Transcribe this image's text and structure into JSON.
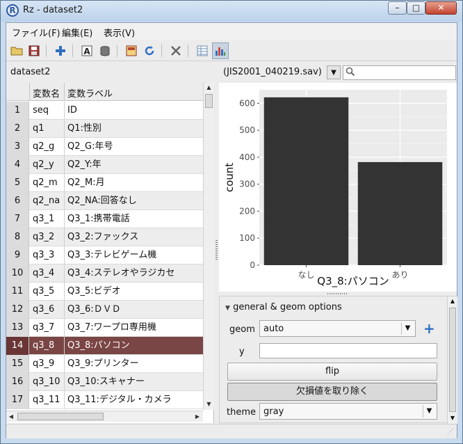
{
  "window": {
    "title": "Rz - dataset2",
    "app_icon_glyph": "R",
    "controls": {
      "minimize": "–",
      "maximize": "□",
      "close": "✕"
    }
  },
  "menu": [
    "ファイル(F)",
    "編集(E)",
    "表示(V)"
  ],
  "toolbar": [
    {
      "name": "open-folder-icon",
      "glyph": "📂",
      "color": "#c9a13b"
    },
    {
      "name": "save-icon",
      "glyph": "💾",
      "color": "#8a2e2e"
    },
    {
      "name": "add-icon",
      "glyph": "+",
      "color": "#2f6fc2"
    },
    {
      "name": "text-icon",
      "glyph": "A",
      "color": "#222222"
    },
    {
      "name": "trash-icon",
      "glyph": "🗑",
      "color": "#555555"
    },
    {
      "name": "data-editor-icon",
      "glyph": "▦",
      "color": "#b5462f"
    },
    {
      "name": "refresh-icon",
      "glyph": "↻",
      "color": "#2f6fc2"
    },
    {
      "name": "tools-icon",
      "glyph": "✂",
      "color": "#555555"
    },
    {
      "name": "table-view-icon",
      "glyph": "▤",
      "color": "#6e8fb5"
    },
    {
      "name": "chart-view-icon",
      "glyph": "▃",
      "color": "#2f6fc2"
    }
  ],
  "dataset": {
    "name": "dataset2",
    "file": "(JIS2001_040219.sav)",
    "search_placeholder": "",
    "search_icon": "🔍"
  },
  "table": {
    "headers": {
      "name": "変数名",
      "label": "変数ラベル"
    },
    "rows": [
      {
        "idx": "1",
        "name": "seq",
        "label": "ID"
      },
      {
        "idx": "2",
        "name": "q1",
        "label": "Q1:性別"
      },
      {
        "idx": "3",
        "name": "q2_g",
        "label": "Q2_G:年号"
      },
      {
        "idx": "4",
        "name": "q2_y",
        "label": "Q2_Y:年"
      },
      {
        "idx": "5",
        "name": "q2_m",
        "label": "Q2_M:月"
      },
      {
        "idx": "6",
        "name": "q2_na",
        "label": "Q2_NA:回答なし"
      },
      {
        "idx": "7",
        "name": "q3_1",
        "label": "Q3_1:携帯電話"
      },
      {
        "idx": "8",
        "name": "q3_2",
        "label": "Q3_2:ファックス"
      },
      {
        "idx": "9",
        "name": "q3_3",
        "label": "Q3_3:テレビゲーム機"
      },
      {
        "idx": "10",
        "name": "q3_4",
        "label": "Q3_4:ステレオやラジカセ"
      },
      {
        "idx": "11",
        "name": "q3_5",
        "label": "Q3_5:ビデオ"
      },
      {
        "idx": "12",
        "name": "q3_6",
        "label": "Q3_6:ＤＶＤ"
      },
      {
        "idx": "13",
        "name": "q3_7",
        "label": "Q3_7:ワープロ専用機"
      },
      {
        "idx": "14",
        "name": "q3_8",
        "label": "Q3_8:パソコン"
      },
      {
        "idx": "15",
        "name": "q3_9",
        "label": "Q3_9:プリンター"
      },
      {
        "idx": "16",
        "name": "q3_10",
        "label": "Q3_10:スキャナー"
      },
      {
        "idx": "17",
        "name": "q3_11",
        "label": "Q3_11:デジタル・カメラ"
      }
    ],
    "selected_index": 13,
    "selected_color": "#7a4545"
  },
  "chart_data": {
    "type": "bar",
    "categories": [
      "なし",
      "あり"
    ],
    "values": [
      622,
      382
    ],
    "xlabel": "Q3_8:パソコン",
    "ylabel": "count",
    "yticks": [
      0,
      100,
      200,
      300,
      400,
      500,
      600
    ],
    "ylim": [
      0,
      650
    ],
    "grid": true,
    "bar_color": "#333333",
    "panel_color": "#ebebeb"
  },
  "options": {
    "section_title": "general & geom options",
    "geom_label": "geom",
    "geom_value": "auto",
    "y_label": "y",
    "y_value": "",
    "flip_label": "flip",
    "missing_label": "欠損値を取り除く",
    "theme_label": "theme",
    "theme_value": "gray"
  }
}
